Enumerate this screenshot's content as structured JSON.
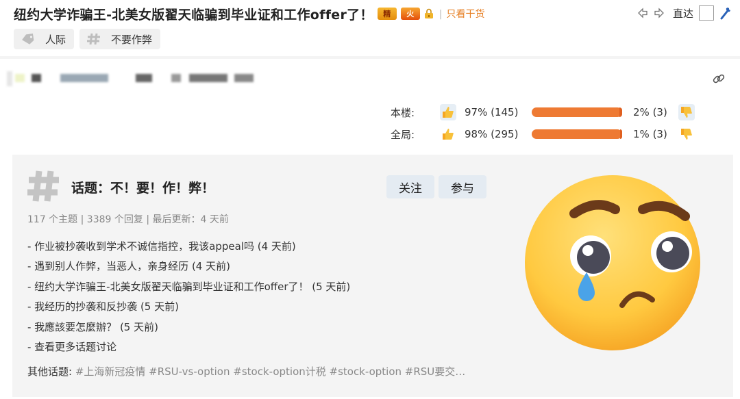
{
  "header": {
    "title": "纽约大学诈骗王-北美女版翟天临骗到毕业证和工作offer了！",
    "badges": [
      {
        "label": "精",
        "color": "#e58e0c"
      },
      {
        "label": "火",
        "color": "#e5500c"
      }
    ],
    "only_goods": "只看干货",
    "goto_label": "直达",
    "tags": [
      {
        "label": "人际",
        "icon": "tag-icon"
      },
      {
        "label": "不要作弊",
        "icon": "hash-icon"
      }
    ]
  },
  "votes": {
    "rows": [
      {
        "label": "本楼:",
        "up": "97% (145)",
        "down": "2% (3)",
        "up_fraction": 0.97
      },
      {
        "label": "全局:",
        "up": "98% (295)",
        "down": "1% (3)",
        "up_fraction": 0.98
      }
    ],
    "bar_color": "#ee7a33"
  },
  "topic": {
    "title": "话题：不！要！作！弊！",
    "follow_label": "关注",
    "join_label": "参与",
    "stats": "117 个主题 | 3389 个回复 | 最后更新：4 天前",
    "items": [
      "- 作业被抄袭收到学术不诚信指控，我该appeal吗 (4 天前)",
      "- 遇到别人作弊，当恶人，亲身经历 (4 天前)",
      "- 纽约大学诈骗王-北美女版翟天临骗到毕业证和工作offer了！ (5 天前)",
      "- 我经历的抄袭和反抄袭 (5 天前)",
      "- 我應該要怎麼辦？ (5 天前)",
      "- 查看更多话题讨论"
    ],
    "other_label": "其他话题:",
    "other_tags": " #上海新冠疫情 #RSU-vs-option #stock-option计税 #stock-option #RSU要交…"
  },
  "colors": {
    "accent": "#e67e22",
    "topic_bg": "#f4f4f4",
    "button_bg": "#e4ebf2"
  }
}
